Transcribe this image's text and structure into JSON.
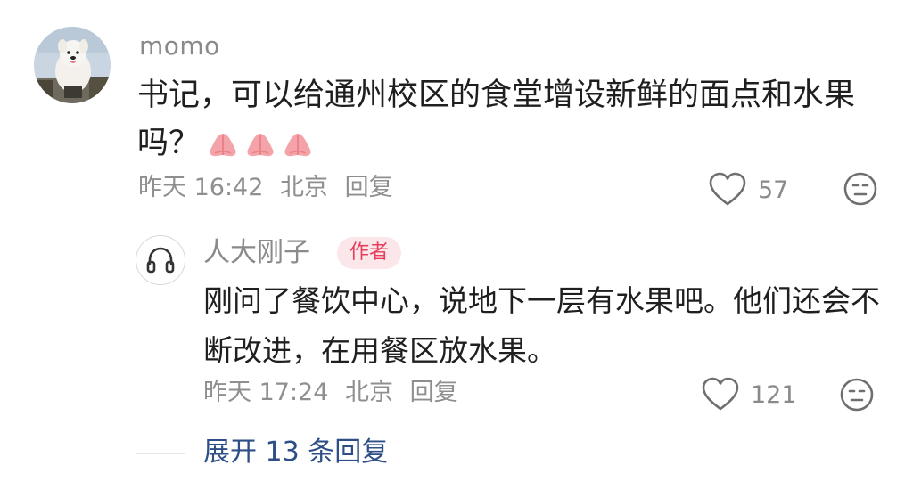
{
  "comment": {
    "username": "momo",
    "text": "书记，可以给通州校区的食堂增设新鲜的面点和水果吗？",
    "reaction_icon": "pray-hands-emoji",
    "time": "昨天 16:42",
    "location": "北京",
    "reply_label": "回复",
    "like_count": "57"
  },
  "reply": {
    "username": "人大刚子",
    "author_badge": "作者",
    "text": "刚问了餐饮中心，说地下一层有水果吧。他们还会不断改进，在用餐区放水果。",
    "time": "昨天 17:24",
    "location": "北京",
    "reply_label": "回复",
    "like_count": "121"
  },
  "expand_replies": "展开 13 条回复",
  "colors": {
    "meta_gray": "#8f8f8f",
    "badge_text": "#e53d5b",
    "badge_bg": "#fbe6ea",
    "link_blue": "#2e4f86"
  }
}
